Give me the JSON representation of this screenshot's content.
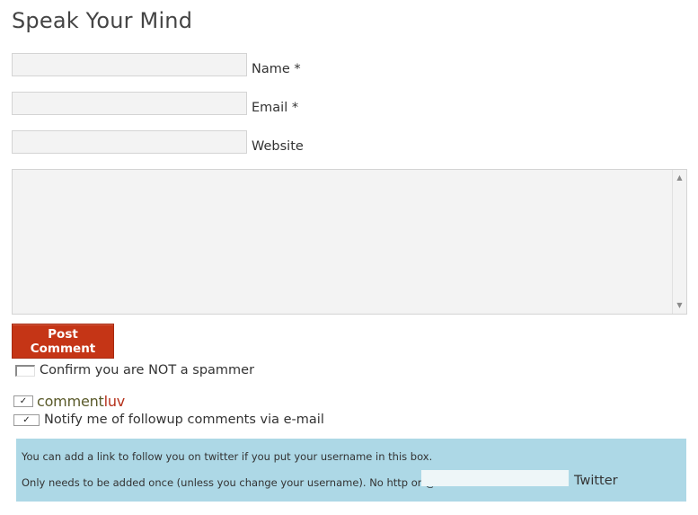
{
  "form": {
    "title": "Speak Your Mind",
    "fields": {
      "name_label": "Name *",
      "email_label": "Email *",
      "website_label": "Website",
      "name_value": "",
      "email_value": "",
      "website_value": ""
    },
    "comment_value": "",
    "post_button_label": "Post Comment",
    "spam_confirm": {
      "label": "Confirm you are NOT a spammer",
      "checked": false
    },
    "commentluv": {
      "text_part1": "comment",
      "text_part2": "luv",
      "checked": true
    },
    "notify": {
      "label": "Notify me of followup comments via e-mail",
      "checked": true
    },
    "twitter": {
      "line1": "You can add a link to follow you on twitter if you put your username in this box.",
      "line2": "Only needs to be added once (unless you change your username). No http or @",
      "input_value": "",
      "label": "Twitter",
      "box_color": "#add8e6"
    },
    "colors": {
      "button_bg": "#c53516",
      "luv_color": "#b5301a"
    }
  }
}
